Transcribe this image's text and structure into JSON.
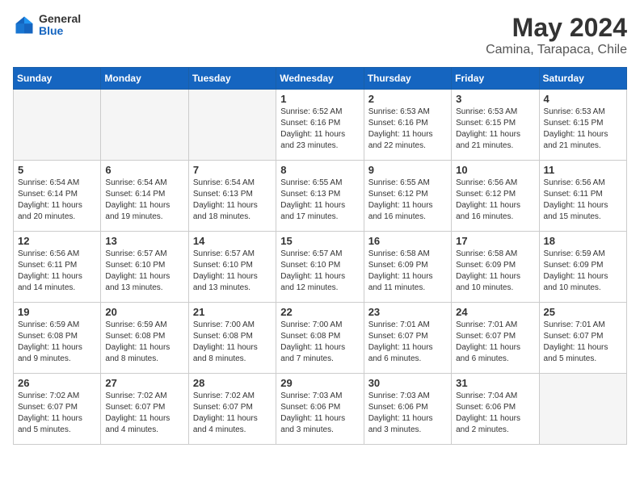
{
  "header": {
    "logo_general": "General",
    "logo_blue": "Blue",
    "month_year": "May 2024",
    "location": "Camina, Tarapaca, Chile"
  },
  "days_of_week": [
    "Sunday",
    "Monday",
    "Tuesday",
    "Wednesday",
    "Thursday",
    "Friday",
    "Saturday"
  ],
  "weeks": [
    [
      {
        "day": "",
        "content": ""
      },
      {
        "day": "",
        "content": ""
      },
      {
        "day": "",
        "content": ""
      },
      {
        "day": "1",
        "content": "Sunrise: 6:52 AM\nSunset: 6:16 PM\nDaylight: 11 hours\nand 23 minutes."
      },
      {
        "day": "2",
        "content": "Sunrise: 6:53 AM\nSunset: 6:16 PM\nDaylight: 11 hours\nand 22 minutes."
      },
      {
        "day": "3",
        "content": "Sunrise: 6:53 AM\nSunset: 6:15 PM\nDaylight: 11 hours\nand 21 minutes."
      },
      {
        "day": "4",
        "content": "Sunrise: 6:53 AM\nSunset: 6:15 PM\nDaylight: 11 hours\nand 21 minutes."
      }
    ],
    [
      {
        "day": "5",
        "content": "Sunrise: 6:54 AM\nSunset: 6:14 PM\nDaylight: 11 hours\nand 20 minutes."
      },
      {
        "day": "6",
        "content": "Sunrise: 6:54 AM\nSunset: 6:14 PM\nDaylight: 11 hours\nand 19 minutes."
      },
      {
        "day": "7",
        "content": "Sunrise: 6:54 AM\nSunset: 6:13 PM\nDaylight: 11 hours\nand 18 minutes."
      },
      {
        "day": "8",
        "content": "Sunrise: 6:55 AM\nSunset: 6:13 PM\nDaylight: 11 hours\nand 17 minutes."
      },
      {
        "day": "9",
        "content": "Sunrise: 6:55 AM\nSunset: 6:12 PM\nDaylight: 11 hours\nand 16 minutes."
      },
      {
        "day": "10",
        "content": "Sunrise: 6:56 AM\nSunset: 6:12 PM\nDaylight: 11 hours\nand 16 minutes."
      },
      {
        "day": "11",
        "content": "Sunrise: 6:56 AM\nSunset: 6:11 PM\nDaylight: 11 hours\nand 15 minutes."
      }
    ],
    [
      {
        "day": "12",
        "content": "Sunrise: 6:56 AM\nSunset: 6:11 PM\nDaylight: 11 hours\nand 14 minutes."
      },
      {
        "day": "13",
        "content": "Sunrise: 6:57 AM\nSunset: 6:10 PM\nDaylight: 11 hours\nand 13 minutes."
      },
      {
        "day": "14",
        "content": "Sunrise: 6:57 AM\nSunset: 6:10 PM\nDaylight: 11 hours\nand 13 minutes."
      },
      {
        "day": "15",
        "content": "Sunrise: 6:57 AM\nSunset: 6:10 PM\nDaylight: 11 hours\nand 12 minutes."
      },
      {
        "day": "16",
        "content": "Sunrise: 6:58 AM\nSunset: 6:09 PM\nDaylight: 11 hours\nand 11 minutes."
      },
      {
        "day": "17",
        "content": "Sunrise: 6:58 AM\nSunset: 6:09 PM\nDaylight: 11 hours\nand 10 minutes."
      },
      {
        "day": "18",
        "content": "Sunrise: 6:59 AM\nSunset: 6:09 PM\nDaylight: 11 hours\nand 10 minutes."
      }
    ],
    [
      {
        "day": "19",
        "content": "Sunrise: 6:59 AM\nSunset: 6:08 PM\nDaylight: 11 hours\nand 9 minutes."
      },
      {
        "day": "20",
        "content": "Sunrise: 6:59 AM\nSunset: 6:08 PM\nDaylight: 11 hours\nand 8 minutes."
      },
      {
        "day": "21",
        "content": "Sunrise: 7:00 AM\nSunset: 6:08 PM\nDaylight: 11 hours\nand 8 minutes."
      },
      {
        "day": "22",
        "content": "Sunrise: 7:00 AM\nSunset: 6:08 PM\nDaylight: 11 hours\nand 7 minutes."
      },
      {
        "day": "23",
        "content": "Sunrise: 7:01 AM\nSunset: 6:07 PM\nDaylight: 11 hours\nand 6 minutes."
      },
      {
        "day": "24",
        "content": "Sunrise: 7:01 AM\nSunset: 6:07 PM\nDaylight: 11 hours\nand 6 minutes."
      },
      {
        "day": "25",
        "content": "Sunrise: 7:01 AM\nSunset: 6:07 PM\nDaylight: 11 hours\nand 5 minutes."
      }
    ],
    [
      {
        "day": "26",
        "content": "Sunrise: 7:02 AM\nSunset: 6:07 PM\nDaylight: 11 hours\nand 5 minutes."
      },
      {
        "day": "27",
        "content": "Sunrise: 7:02 AM\nSunset: 6:07 PM\nDaylight: 11 hours\nand 4 minutes."
      },
      {
        "day": "28",
        "content": "Sunrise: 7:02 AM\nSunset: 6:07 PM\nDaylight: 11 hours\nand 4 minutes."
      },
      {
        "day": "29",
        "content": "Sunrise: 7:03 AM\nSunset: 6:06 PM\nDaylight: 11 hours\nand 3 minutes."
      },
      {
        "day": "30",
        "content": "Sunrise: 7:03 AM\nSunset: 6:06 PM\nDaylight: 11 hours\nand 3 minutes."
      },
      {
        "day": "31",
        "content": "Sunrise: 7:04 AM\nSunset: 6:06 PM\nDaylight: 11 hours\nand 2 minutes."
      },
      {
        "day": "",
        "content": ""
      }
    ]
  ]
}
